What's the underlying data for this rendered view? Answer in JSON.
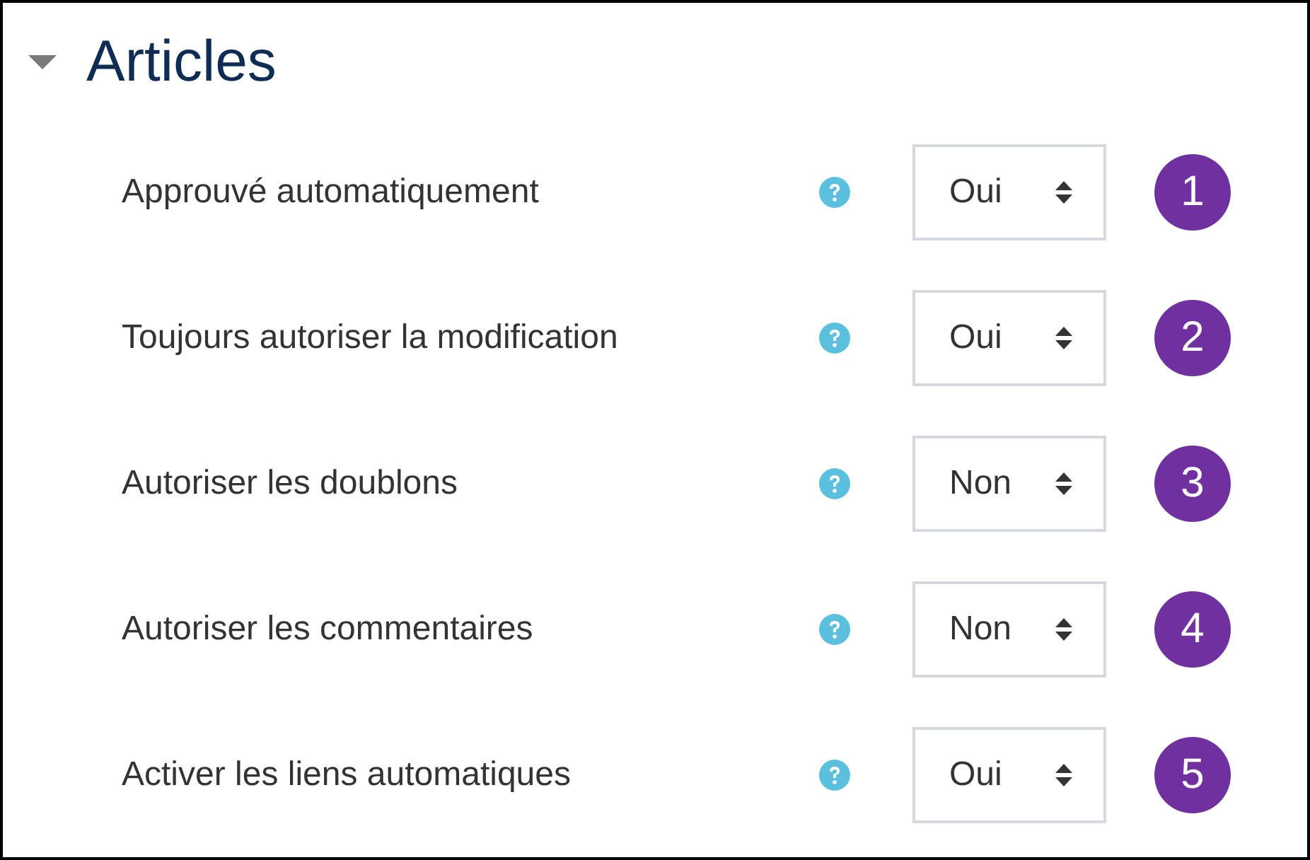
{
  "section": {
    "title": "Articles",
    "expanded": true
  },
  "settings": [
    {
      "label": "Approuvé automatiquement",
      "value": "Oui",
      "badge": "1"
    },
    {
      "label": "Toujours autoriser la modification",
      "value": "Oui",
      "badge": "2"
    },
    {
      "label": "Autoriser les doublons",
      "value": "Non",
      "badge": "3"
    },
    {
      "label": "Autoriser les commentaires",
      "value": "Non",
      "badge": "4"
    },
    {
      "label": "Activer les liens automatiques",
      "value": "Oui",
      "badge": "5"
    }
  ]
}
